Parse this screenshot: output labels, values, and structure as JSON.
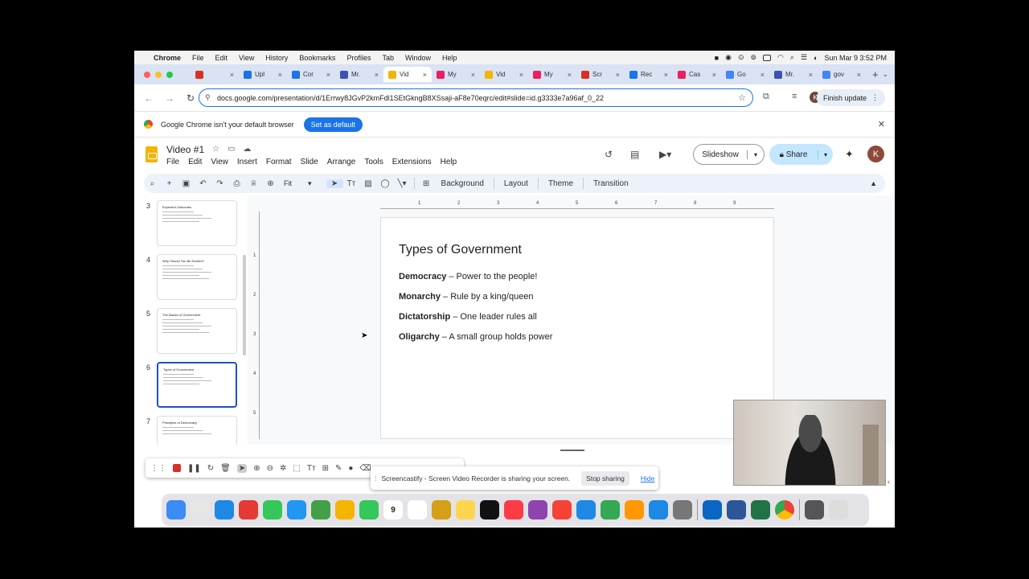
{
  "menubar": {
    "app": "Chrome",
    "items": [
      "File",
      "Edit",
      "View",
      "History",
      "Bookmarks",
      "Profiles",
      "Tab",
      "Window",
      "Help"
    ],
    "datetime": "Sun Mar 9  3:52 PM"
  },
  "tabs": [
    {
      "label": "",
      "color": "#d93025"
    },
    {
      "label": "Upl",
      "color": "#1a73e8"
    },
    {
      "label": "Cor",
      "color": "#1a73e8"
    },
    {
      "label": "Mr.",
      "color": "#3f51b5"
    },
    {
      "label": "Vid",
      "color": "#f4b400",
      "active": true
    },
    {
      "label": "My",
      "color": "#e91e63"
    },
    {
      "label": "Vid",
      "color": "#f4b400"
    },
    {
      "label": "My",
      "color": "#e91e63"
    },
    {
      "label": "Scr",
      "color": "#d93025"
    },
    {
      "label": "Rec",
      "color": "#1a73e8"
    },
    {
      "label": "Cas",
      "color": "#e91e63"
    },
    {
      "label": "Go",
      "color": "#4285f4"
    },
    {
      "label": "Mr.",
      "color": "#3f51b5"
    },
    {
      "label": "gov",
      "color": "#4285f4"
    }
  ],
  "address": {
    "url": "docs.google.com/presentation/d/1Errwy8JGvP2kmFdl1SEtGkngB8XSsaji-aF8e70eqrc/edit#slide=id.g3333e7a96af_0_22",
    "finish_update": "Finish update",
    "profile_initial": "K"
  },
  "infobar": {
    "message": "Google Chrome isn't your default browser",
    "button": "Set as default"
  },
  "slides_app": {
    "doc_title": "Video #1",
    "menu": [
      "File",
      "Edit",
      "View",
      "Insert",
      "Format",
      "Slide",
      "Arrange",
      "Tools",
      "Extensions",
      "Help"
    ],
    "slideshow_label": "Slideshow",
    "share_label": "Share",
    "avatar_initial": "K"
  },
  "toolbar": {
    "zoom": "Fit",
    "background": "Background",
    "layout": "Layout",
    "theme": "Theme",
    "transition": "Transition"
  },
  "filmstrip": [
    {
      "num": "3",
      "title": "Expected Outcomes",
      "lines": 4
    },
    {
      "num": "4",
      "title": "Why Should You Be Excited?",
      "lines": 5
    },
    {
      "num": "5",
      "title": "The Basics of Government",
      "lines": 5
    },
    {
      "num": "6",
      "title": "Types of Government",
      "lines": 4,
      "selected": true
    },
    {
      "num": "7",
      "title": "Principles of Democracy",
      "lines": 3
    }
  ],
  "ruler": {
    "h": [
      "1",
      "2",
      "3",
      "4",
      "5",
      "6",
      "7",
      "8",
      "9"
    ],
    "v": [
      "1",
      "2",
      "3",
      "4",
      "5"
    ]
  },
  "slide": {
    "title": "Types of Government",
    "items": [
      {
        "term": "Democracy",
        "desc": " – Power to the people!"
      },
      {
        "term": "Monarchy",
        "desc": " – Rule by a king/queen"
      },
      {
        "term": "Dictatorship",
        "desc": " – One leader rules all"
      },
      {
        "term": "Oligarchy",
        "desc": " – A small group holds power"
      }
    ]
  },
  "screencastify": {
    "message": "Screencastify - Screen Video Recorder is sharing your screen.",
    "stop": "Stop sharing",
    "hide": "Hide"
  },
  "dock": {
    "calendar_day": "9",
    "apps": [
      "finder-icon",
      "launchpad-icon",
      "safari-icon",
      "opera-icon",
      "messages-icon",
      "mail-icon",
      "maps-icon",
      "photos-icon",
      "facetime-icon",
      "calendar-icon",
      "reminders-icon",
      "notes-folder-icon",
      "notes-icon",
      "appletv-icon",
      "music-icon",
      "podcasts-icon",
      "news-icon",
      "keynote-icon",
      "numbers-icon",
      "pages-icon",
      "appstore-icon",
      "settings-icon",
      "outlook-icon",
      "word-icon",
      "excel-icon",
      "chrome-icon",
      "downloads-icon",
      "trash-icon"
    ]
  }
}
